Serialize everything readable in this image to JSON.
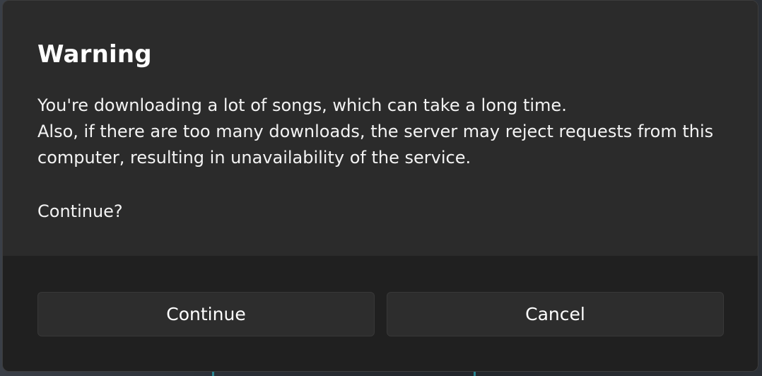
{
  "dialog": {
    "title": "Warning",
    "message_lines": [
      "You're downloading a lot of songs, which can take a long time.",
      "Also, if there are too many downloads, the server may reject requests from this",
      "computer, resulting in unavailability of the service."
    ],
    "question": "Continue?",
    "buttons": {
      "primary": "Continue",
      "secondary": "Cancel"
    }
  },
  "colors": {
    "dialog_body": "#2b2b2b",
    "dialog_footer": "#202020",
    "button_bg": "#2d2d2d",
    "text": "#ffffff"
  }
}
